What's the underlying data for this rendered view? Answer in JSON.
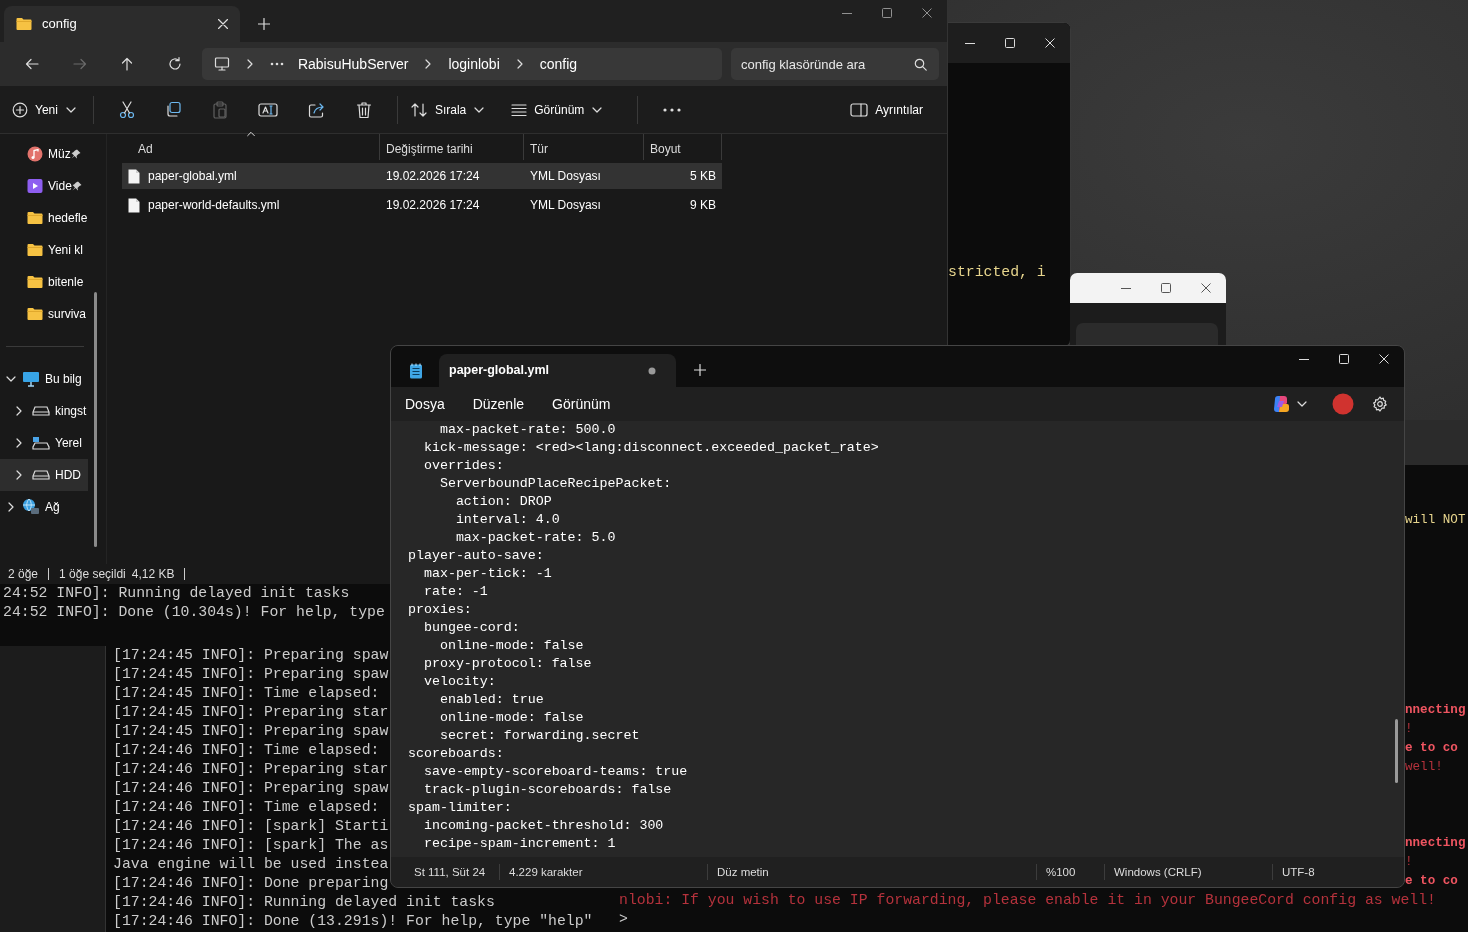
{
  "explorer": {
    "tabs": [
      {
        "label": "config",
        "selected": true
      }
    ],
    "nav_buttons": [
      {
        "kind": "back",
        "disabled": false
      },
      {
        "kind": "forward",
        "disabled": true
      },
      {
        "kind": "up",
        "disabled": false
      },
      {
        "kind": "refresh",
        "disabled": false
      }
    ],
    "breadcrumbs": [
      "RabisuHubServer",
      "loginlobi",
      "config"
    ],
    "search": {
      "placeholder": "config klasöründe ara"
    },
    "toolbar": [
      {
        "kind": "new",
        "label": "Yeni"
      },
      {
        "kind": "cut",
        "disabled": false
      },
      {
        "kind": "copy",
        "disabled": false
      },
      {
        "kind": "paste",
        "disabled": true
      },
      {
        "kind": "rename",
        "disabled": false
      },
      {
        "kind": "share",
        "disabled": false
      },
      {
        "kind": "delete",
        "disabled": false
      },
      {
        "kind": "sort",
        "label": "Sırala"
      },
      {
        "kind": "view",
        "label": "Görünüm"
      },
      {
        "kind": "more"
      }
    ],
    "details_button": {
      "label": "Ayrıntılar"
    },
    "quick_access": [
      {
        "label": "Müz",
        "kind": "music",
        "pinned": true,
        "selected": false
      },
      {
        "label": "Vide",
        "kind": "video",
        "pinned": true,
        "selected": false
      },
      {
        "label": "hedefle",
        "kind": "folder",
        "pinned": false,
        "selected": false
      },
      {
        "label": "Yeni kl",
        "kind": "folder",
        "pinned": false,
        "selected": false
      },
      {
        "label": "bitenle",
        "kind": "folder",
        "pinned": false,
        "selected": false
      },
      {
        "label": "surviva",
        "kind": "folder",
        "pinned": false,
        "selected": false
      }
    ],
    "tree": [
      {
        "label": "Bu bilg",
        "kind": "pc",
        "expanded": true,
        "selected": false,
        "children": [
          {
            "label": "kingst",
            "kind": "drive",
            "expanded": false,
            "selected": false
          },
          {
            "label": "Yerel",
            "kind": "localdrive",
            "expanded": false,
            "selected": false
          },
          {
            "label": "HDD",
            "kind": "drive",
            "expanded": false,
            "selected": true
          }
        ]
      },
      {
        "label": "Ağ",
        "kind": "network",
        "expanded": false,
        "selected": false
      }
    ],
    "columns": [
      {
        "label": "Ad",
        "sorted": true
      },
      {
        "label": "Değiştirme tarihi",
        "sorted": false
      },
      {
        "label": "Tür",
        "sorted": false
      },
      {
        "label": "Boyut",
        "sorted": false
      }
    ],
    "files": [
      {
        "name": "paper-global.yml",
        "modified": "19.02.2026 17:24",
        "type": "YML Dosyası",
        "size": "5 KB",
        "selected": true
      },
      {
        "name": "paper-world-defaults.yml",
        "modified": "19.02.2026 17:24",
        "type": "YML Dosyası",
        "size": "9 KB",
        "selected": false
      }
    ],
    "status": {
      "items": "2 öğe",
      "selection": "1 öğe seçildi",
      "size": "4,12 KB"
    }
  },
  "console_top_right": {
    "lines": [
      "stricted, i"
    ]
  },
  "console_left_upper": {
    "lines": [
      "24:52 INFO]: Running delayed init tasks",
      "24:52 INFO]: Done (10.304s)! For help, type"
    ]
  },
  "console_left_lower": {
    "lines": [
      "[17:24:45 INFO]: Preparing spaw",
      "[17:24:45 INFO]: Preparing spaw",
      "[17:24:45 INFO]: Time elapsed:",
      "[17:24:45 INFO]: Preparing star",
      "[17:24:45 INFO]: Preparing spaw",
      "[17:24:46 INFO]: Time elapsed:",
      "[17:24:46 INFO]: Preparing star",
      "[17:24:46 INFO]: Preparing spaw",
      "[17:24:46 INFO]: Time elapsed:",
      "[17:24:46 INFO]: [spark] Starti",
      "[17:24:46 INFO]: [spark] The as",
      "Java engine will be used instea",
      "[17:24:46 INFO]: Done preparing",
      "[17:24:46 INFO]: Running delayed init tasks",
      "[17:24:46 INFO]: Done (13.291s)! For help, type \"help\""
    ]
  },
  "console_right": {
    "fragment_groups": [
      {
        "lines": [
          {
            "kind": "warning",
            "text": "will NOT"
          }
        ]
      },
      {
        "lines": [
          {
            "kind": "error",
            "text": "nnecting"
          },
          {
            "kind": "error_dim",
            "text": "!"
          },
          {
            "kind": "error",
            "text": "e to co"
          },
          {
            "kind": "error_dim",
            "text": "well!"
          }
        ]
      },
      {
        "lines": [
          {
            "kind": "error",
            "text": "nnecting"
          },
          {
            "kind": "error_dim",
            "text": "!"
          },
          {
            "kind": "error",
            "text": "e to co"
          }
        ]
      }
    ],
    "lines": [
      {
        "kind": "error_dim",
        "text": "nlobi: If you wish to use IP forwarding, please enable it in your BungeeCord config as well!"
      },
      {
        "kind": "prompt",
        "text": ">"
      }
    ]
  },
  "notepad": {
    "tabs": [
      {
        "label": "paper-global.yml",
        "unsaved": true,
        "selected": true
      }
    ],
    "menu": [
      "Dosya",
      "Düzenle",
      "Görünüm"
    ],
    "lines": [
      "    max-packet-rate: 500.0",
      "  kick-message: <red><lang:disconnect.exceeded_packet_rate>",
      "  overrides:",
      "    ServerboundPlaceRecipePacket:",
      "      action: DROP",
      "      interval: 4.0",
      "      max-packet-rate: 5.0",
      "player-auto-save:",
      "  max-per-tick: -1",
      "  rate: -1",
      "proxies:",
      "  bungee-cord:",
      "    online-mode: false",
      "  proxy-protocol: false",
      "  velocity:",
      "    enabled: true",
      "    online-mode: false",
      "    secret: forwarding.secret",
      "scoreboards:",
      "  save-empty-scoreboard-teams: true",
      "  track-plugin-scoreboards: false",
      "spam-limiter:",
      "  incoming-packet-threshold: 300",
      "  recipe-spam-increment: 1"
    ],
    "status": [
      "St 111, Süt 24",
      "4.229 karakter",
      "Düz metin",
      "%100",
      "Windows (CRLF)",
      "UTF-8"
    ]
  }
}
